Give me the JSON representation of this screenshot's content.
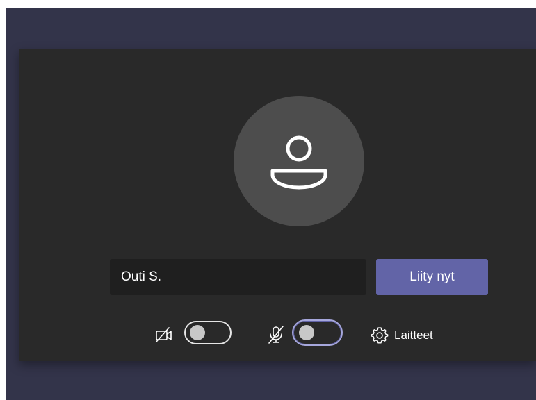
{
  "prejoin": {
    "name_value": "Outi S.",
    "join_label": "Liity nyt",
    "devices_label": "Laitteet",
    "camera_on": false,
    "mic_on": false
  },
  "icons": {
    "avatar": "person-icon",
    "camera": "video-off-icon",
    "mic": "mic-off-icon",
    "devices": "gear-icon"
  },
  "colors": {
    "background": "#33344a",
    "panel": "#292929",
    "accent": "#6264a7",
    "avatar": "#4d4d4d",
    "input": "#1f1f1f"
  }
}
